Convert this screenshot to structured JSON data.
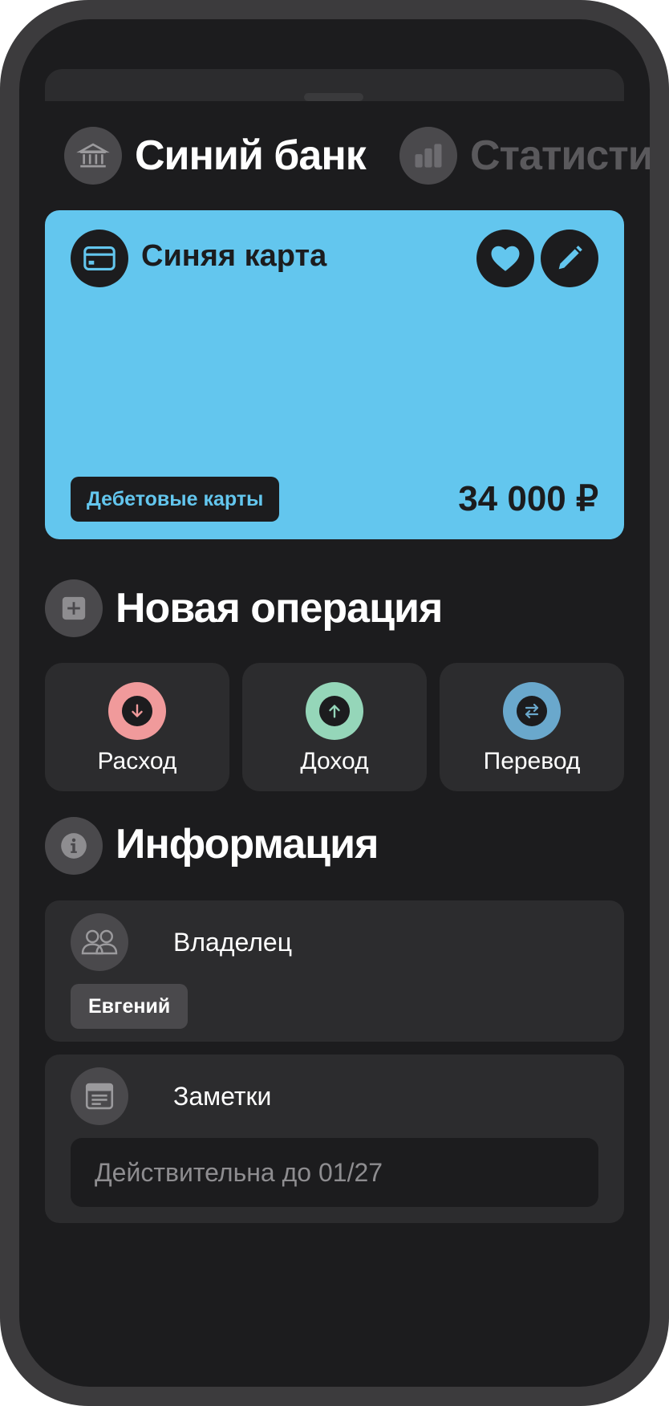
{
  "header": {
    "bank_title": "Синий банк",
    "stats_tab": "Статистика"
  },
  "card": {
    "name": "Синяя карта",
    "category": "Дебетовые карты",
    "balance": "34 000 ₽",
    "color": "#63c6ee"
  },
  "new_operation": {
    "title": "Новая операция",
    "buttons": [
      {
        "label": "Расход",
        "color": "#f09a9b",
        "icon": "arrow-down-icon"
      },
      {
        "label": "Доход",
        "color": "#95d6b9",
        "icon": "arrow-up-icon"
      },
      {
        "label": "Перевод",
        "color": "#6aa8cc",
        "icon": "transfer-icon"
      }
    ]
  },
  "info": {
    "title": "Информация",
    "owner": {
      "label": "Владелец",
      "value": "Евгений"
    },
    "notes": {
      "label": "Заметки",
      "value": "Действительна до 01/27"
    }
  }
}
